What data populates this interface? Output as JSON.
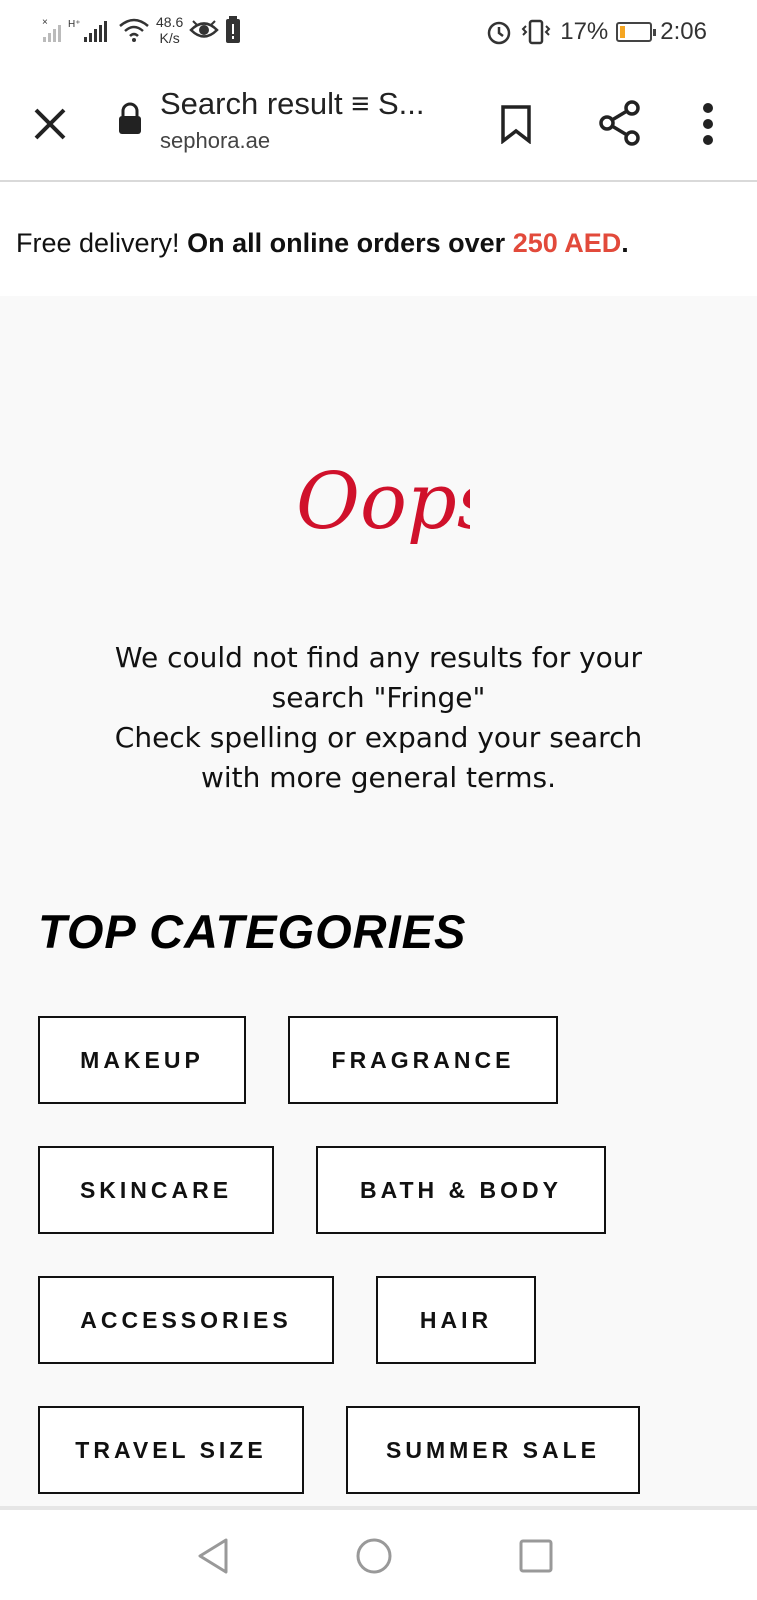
{
  "status_bar": {
    "network_speed": "48.6",
    "network_unit": "K/s",
    "network_type": "H+",
    "battery_percent": "17%",
    "battery_level": 0.17,
    "time": "2:06",
    "icons": [
      "signal-icon",
      "wifi-icon",
      "eye-icon",
      "battery-alert-icon",
      "alarm-icon",
      "vibrate-icon",
      "battery-icon"
    ]
  },
  "browser": {
    "title": "Search result ≡ S...",
    "url": "sephora.ae",
    "icons": [
      "close-icon",
      "lock-icon",
      "bookmark-icon",
      "share-icon",
      "more-vert-icon"
    ]
  },
  "promo": {
    "lead": "Free delivery!",
    "body": "On all online orders over",
    "amount": "250 AED",
    "end": "."
  },
  "message": {
    "heading_script": "Oops",
    "line1": "We could not find any results for your",
    "line2": "search \"Fringe\"",
    "line3": "Check spelling or expand your search",
    "line4": "with more general terms."
  },
  "categories": {
    "title": "TOP CATEGORIES",
    "items": [
      "MAKEUP",
      "FRAGRANCE",
      "SKINCARE",
      "BATH & BODY",
      "ACCESSORIES",
      "HAIR",
      "TRAVEL SIZE",
      "SUMMER SALE"
    ]
  },
  "colors": {
    "accent": "#e24a3b",
    "oops_red": "#d0112b"
  },
  "nav_bar": {
    "icons": [
      "back-icon",
      "home-icon",
      "recents-icon"
    ]
  }
}
